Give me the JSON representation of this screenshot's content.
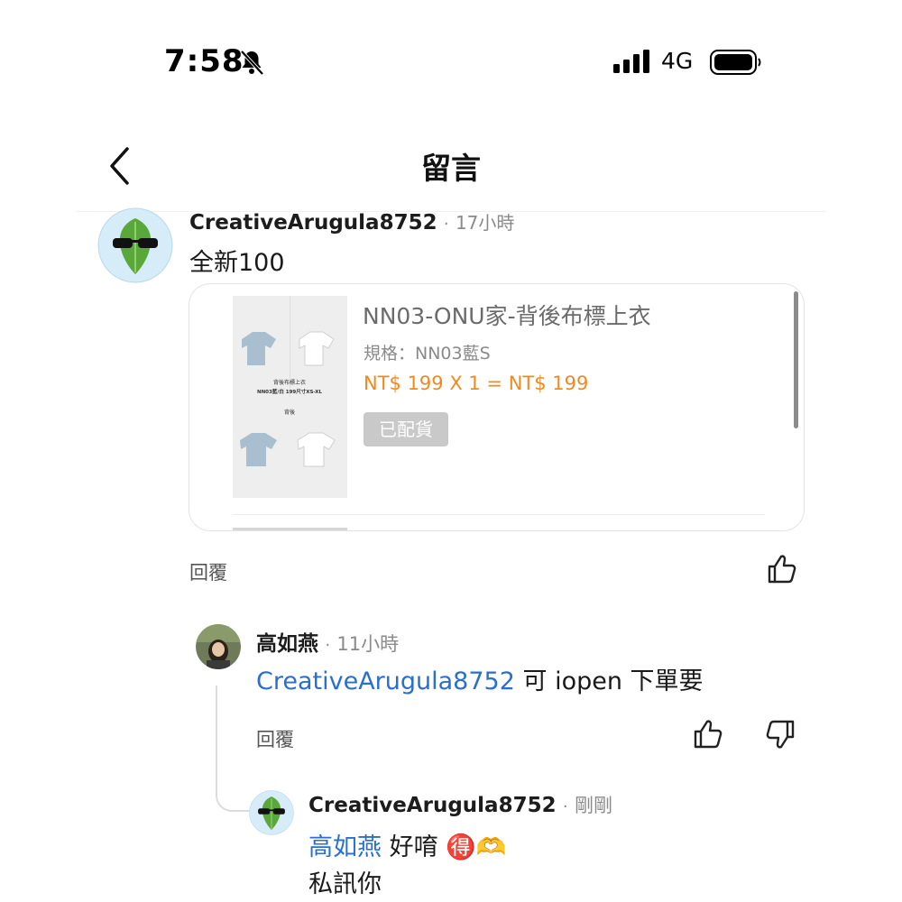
{
  "status_bar": {
    "time": "7:58",
    "network": "4G"
  },
  "header": {
    "title": "留言"
  },
  "comments": [
    {
      "username": "CreativeArugula8752",
      "separator": "·",
      "time": "17小時",
      "text": "全新100",
      "reply_label": "回覆",
      "product": {
        "title": "NN03-ONU家-背後布標上衣",
        "spec": "規格：NN03藍S",
        "price": "NT$ 199 X 1 = NT$ 199",
        "status": "已配貨",
        "image_caption_1": "背後布標上衣",
        "image_caption_2": "NN03藍/白 199尺寸XS-XL",
        "image_caption_3": "背後"
      }
    },
    {
      "username": "高如燕",
      "separator": "·",
      "time": "11小時",
      "mention": "CreativeArugula8752",
      "text": "可 iopen 下單要",
      "reply_label": "回覆"
    },
    {
      "username": "CreativeArugula8752",
      "separator": "·",
      "time": "剛剛",
      "mention": "高如燕",
      "text": "好唷",
      "emoji": "🉐🫶",
      "text_line2": "私訊你"
    }
  ],
  "colors": {
    "mention": "#2a6fcd",
    "price": "#f08a1e",
    "status_bg": "#c9c9c9"
  },
  "icons": [
    "bell-slash-icon",
    "signal-icon",
    "battery-icon",
    "back-chevron-icon",
    "thumbs-up-icon",
    "thumbs-down-icon"
  ]
}
